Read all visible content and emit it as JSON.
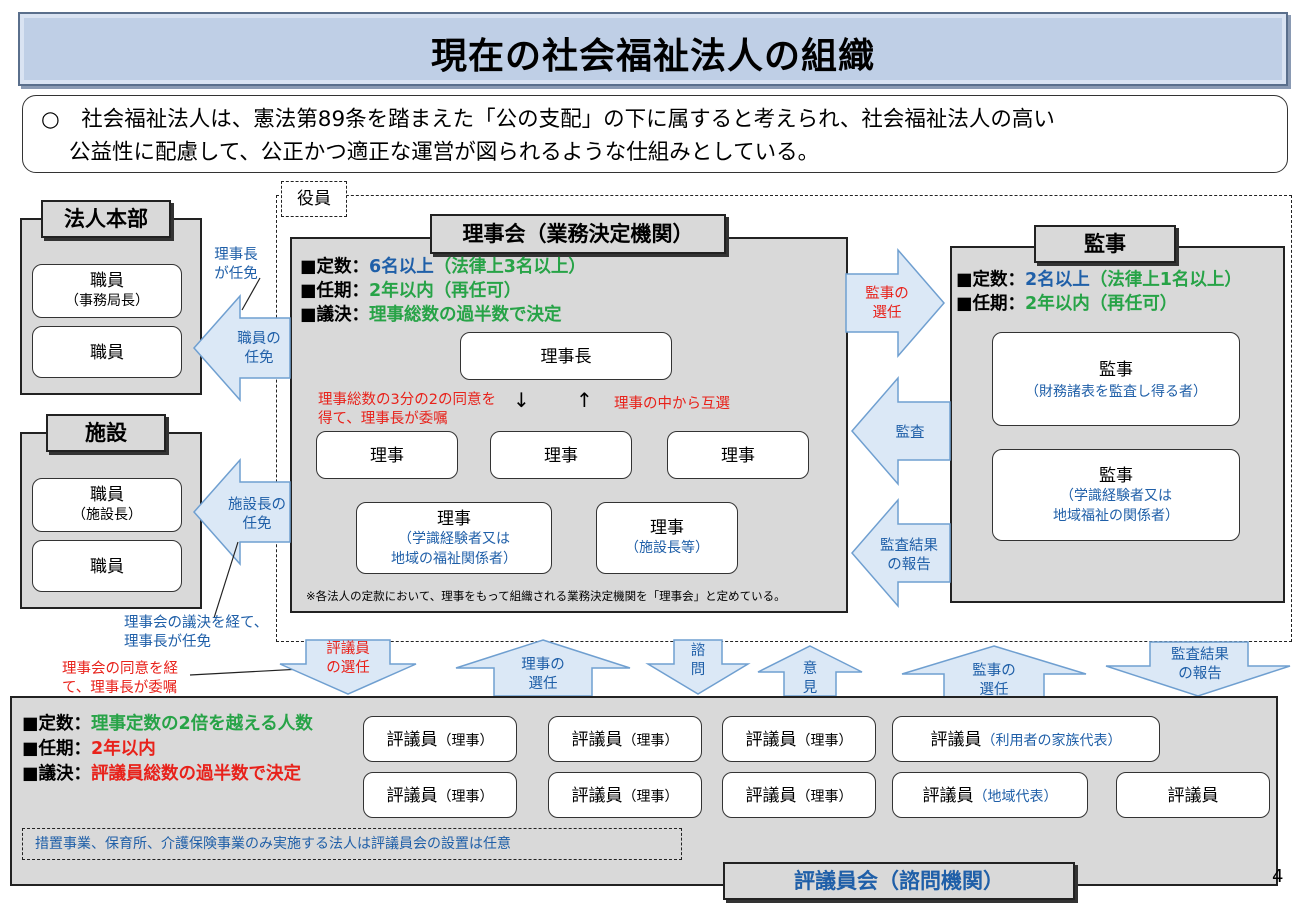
{
  "title": "現在の社会福祉法人の組織",
  "intro": {
    "bullet": "○",
    "line1": "社会福祉法人は、憲法第89条を踏まえた「公の支配」の下に属すると考えられ、社会福祉法人の高い",
    "line2": "公益性に配慮して、公正かつ適正な運営が図られるような仕組みとしている。"
  },
  "yakuin_label": "役員",
  "hq": {
    "title": "法人本部",
    "staff1": "職員",
    "staff1_sub": "（事務局長）",
    "staff2": "職員"
  },
  "facility": {
    "title": "施設",
    "staff1": "職員",
    "staff1_sub": "（施設長）",
    "staff2": "職員"
  },
  "board": {
    "title": "理事会（業務決定機関）",
    "quota_key": "■定数：",
    "quota_val": "6名以上",
    "quota_note": "（法律上3名以上）",
    "term_key": "■任期：",
    "term_val": "2年以内（再任可）",
    "vote_key": "■議決：",
    "vote_val": "理事総数の過半数で決定",
    "chair": "理事長",
    "appoint_note_1": "理事総数の3分の2の同意を",
    "appoint_note_2": "得て、理事長が委嘱",
    "mutual_note": "理事の中から互選",
    "down_arrow": "↓",
    "up_arrow": "↑",
    "director1": "理事",
    "director2": "理事",
    "director3": "理事",
    "director4": "理事",
    "director4_sub1": "（学識経験者又は",
    "director4_sub2": "地域の福祉関係者）",
    "director5": "理事",
    "director5_sub": "（施設長等）",
    "footnote": "※各法人の定款において、理事をもって組織される業務決定機関を「理事会」と定めている。"
  },
  "auditor": {
    "title": "監事",
    "quota_key": "■定数：",
    "quota_val": "2名以上",
    "quota_note": "（法律上1名以上）",
    "term_key": "■任期：",
    "term_val": "2年以内（再任可）",
    "a1": "監事",
    "a1_sub": "（財務諸表を監査し得る者）",
    "a2": "監事",
    "a2_sub1": "（学識経験者又は",
    "a2_sub2": "地域福祉の関係者）"
  },
  "arrows": {
    "chair_appoint_1": "理事長",
    "chair_appoint_2": "が任免",
    "staff_appoint_1": "職員の",
    "staff_appoint_2": "任免",
    "fac_head_1": "施設長の",
    "fac_head_2": "任免",
    "board_decision_1": "理事会の議決を経て、",
    "board_decision_2": "理事長が任免",
    "council_consent_1": "理事会の同意を経",
    "council_consent_2": "て、理事長が委嘱",
    "aud_select_1": "監事の",
    "aud_select_2": "選任",
    "audit": "監査",
    "audit_report_1": "監査結果",
    "audit_report_2": "の報告",
    "councilor_select_1": "評議員",
    "councilor_select_2": "の選任",
    "director_select_1": "理事の",
    "director_select_2": "選任",
    "consult_1": "諮",
    "consult_2": "問",
    "opinion_1": "意",
    "opinion_2": "見",
    "aud_select2_1": "監事の",
    "aud_select2_2": "選任",
    "audit_report2_1": "監査結果",
    "audit_report2_2": "の報告"
  },
  "council": {
    "title": "評議員会（諮問機関）",
    "quota_key": "■定数：",
    "quota_val": "理事定数の2倍を越える人数",
    "term_key": "■任期：",
    "term_val": "2年以内",
    "vote_key": "■議決：",
    "vote_val": "評議員総数の過半数で決定",
    "member": "評議員",
    "m_director": "（理事）",
    "m_family": "（利用者の家族代表）",
    "m_local": "（地域代表）",
    "note": "措置事業、保育所、介護保険事業のみ実施する法人は評議員会の設置は任意"
  },
  "page_number": "4",
  "colors": {
    "blue": "#1f5fa8",
    "green": "#27a347",
    "red": "#e8221b",
    "arrow_fill": "#dbe8f6",
    "arrow_stroke": "#6f9fd0"
  }
}
